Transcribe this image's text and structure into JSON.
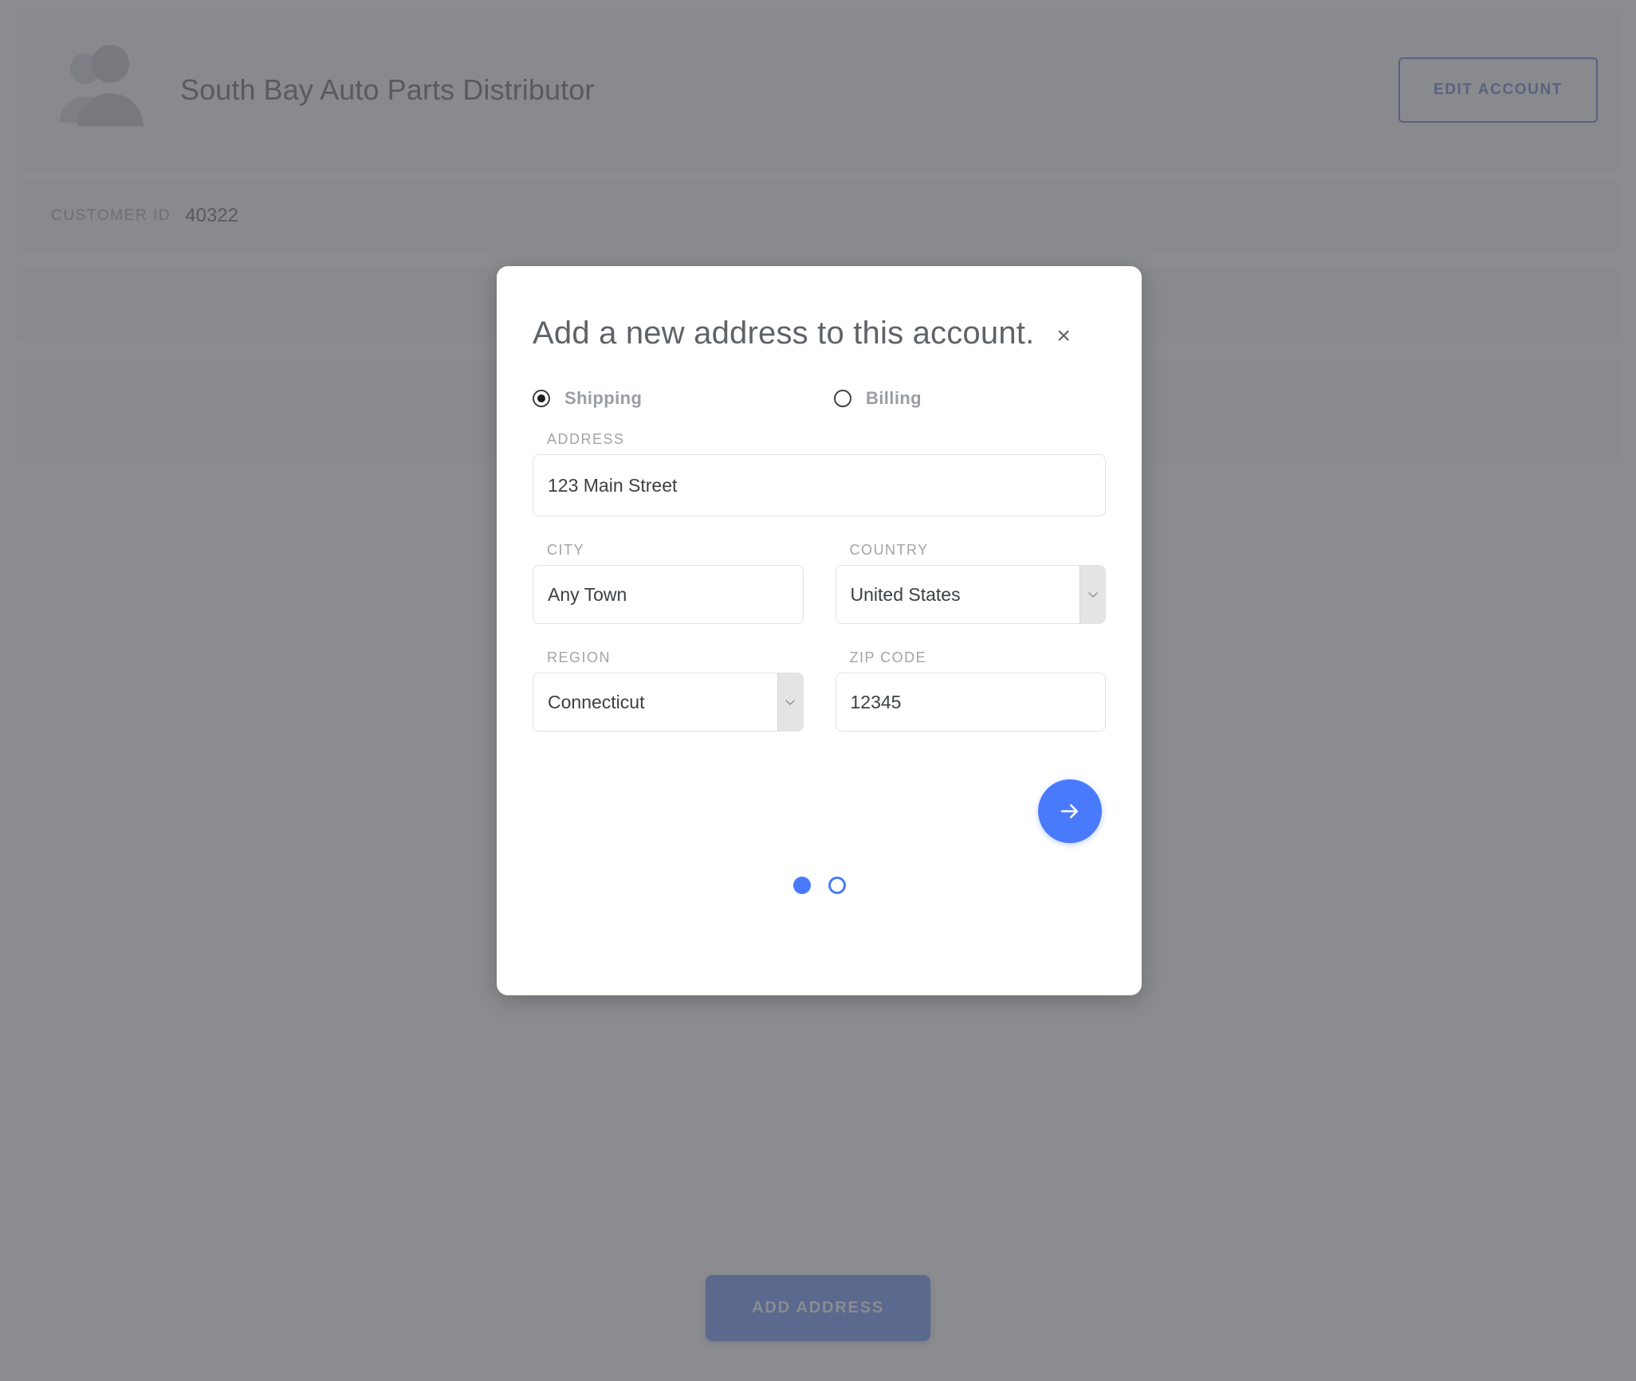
{
  "account": {
    "name": "South Bay Auto Parts Distributor",
    "avatar_icon": "group-people-icon",
    "edit_button_label": "EDIT ACCOUNT",
    "customer_id_label": "CUSTOMER ID",
    "customer_id_value": "40322"
  },
  "page": {
    "add_address_button_label": "ADD ADDRESS"
  },
  "modal": {
    "title": "Add a new address to this account.",
    "close_label": "×",
    "close_icon": "close-icon",
    "address_type": {
      "selected": "Shipping",
      "options": [
        {
          "label": "Shipping",
          "checked": true
        },
        {
          "label": "Billing",
          "checked": false
        }
      ]
    },
    "fields": {
      "address": {
        "label": "ADDRESS",
        "value": "123 Main Street",
        "placeholder": ""
      },
      "city": {
        "label": "CITY",
        "value": "Any Town",
        "placeholder": ""
      },
      "country": {
        "label": "COUNTRY",
        "value": "United States",
        "icon": "chevron-down-icon"
      },
      "region": {
        "label": "REGION",
        "value": "Connecticut",
        "icon": "chevron-down-icon"
      },
      "zip": {
        "label": "ZIP CODE",
        "value": "12345",
        "placeholder": ""
      }
    },
    "next_button": {
      "icon": "arrow-right-icon",
      "label": ""
    },
    "pagination": {
      "current_page": 1,
      "total_pages": 2,
      "dots": [
        {
          "active": true
        },
        {
          "active": false
        }
      ]
    }
  },
  "colors": {
    "accent_blue": "#4a7afc",
    "edit_button_blue": "#3f5fbf",
    "overlay": "rgba(97,100,105,0.74)",
    "text_dark": "#3c4043",
    "text_muted": "#9a9da1",
    "label_gray": "#a0a4a8",
    "card_gray": "#f6f6f6",
    "input_border": "#dfe1e3"
  }
}
